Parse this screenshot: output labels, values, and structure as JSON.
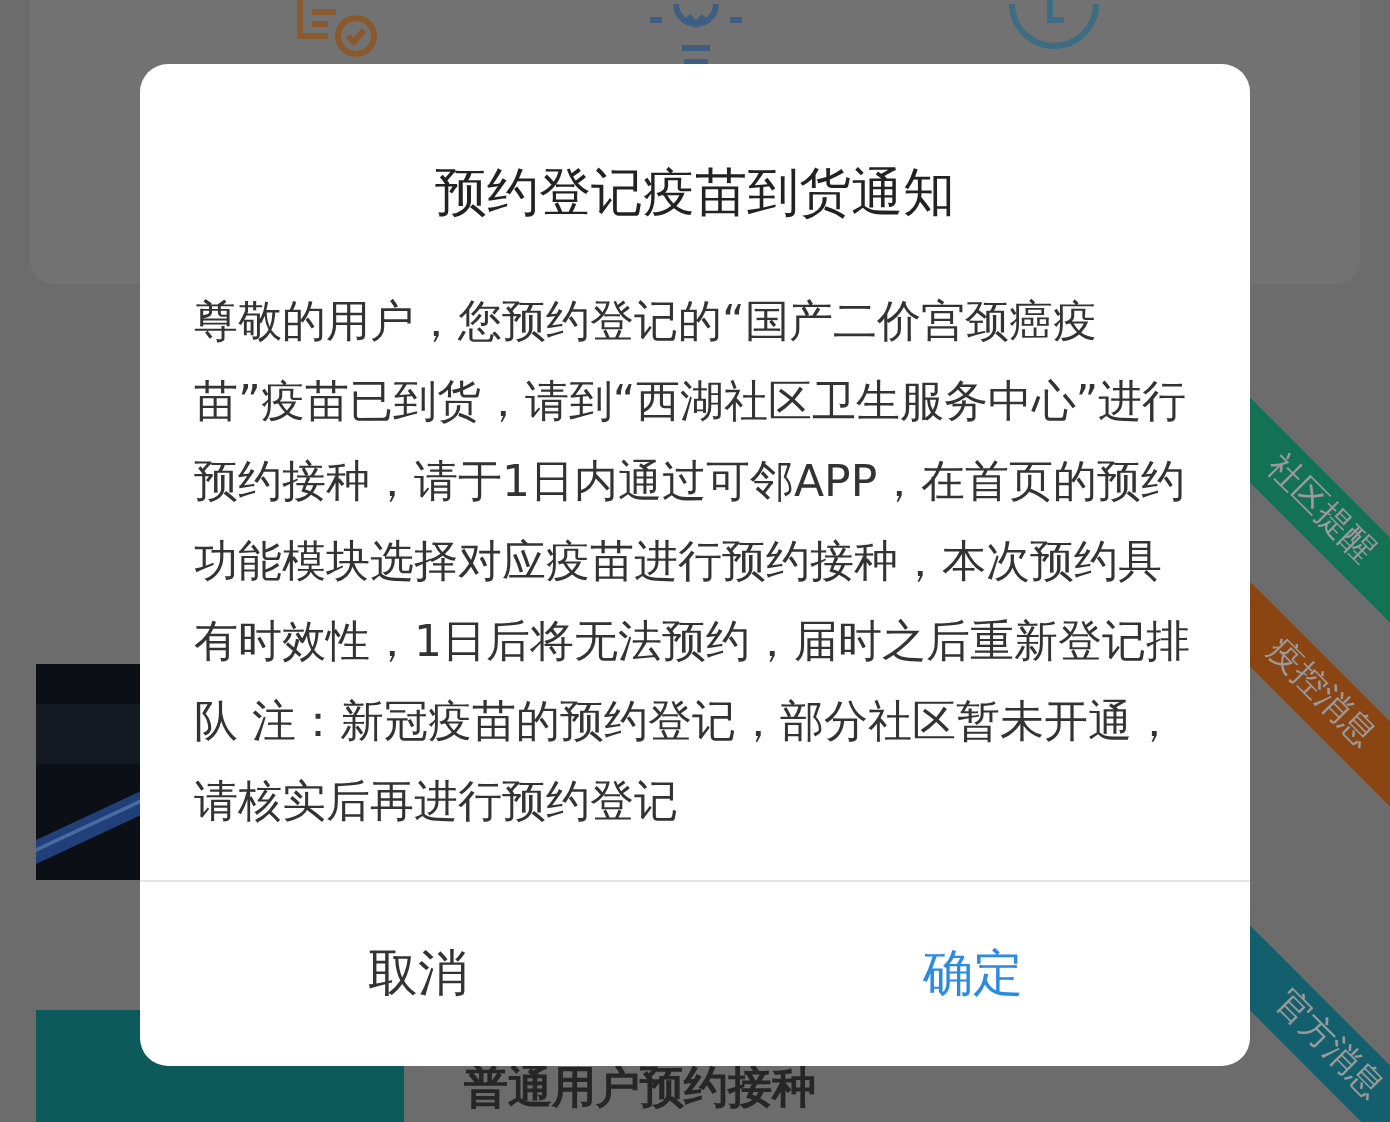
{
  "background": {
    "ribbons": [
      {
        "label": "社区提醒",
        "color": "#137254"
      },
      {
        "label": "疫控消息",
        "color": "#8a4513"
      },
      {
        "label": "官方消息",
        "color": "#135f6d"
      }
    ],
    "list_item_title": "普通用户预约接种"
  },
  "dialog": {
    "title": "预约登记疫苗到货通知",
    "message": "尊敬的用户，您预约登记的“国产二价宫颈癌疫苗”疫苗已到货，请到“西湖社区卫生服务中心”进行预约接种，请于1日内通过可邻APP，在首页的预约功能模块选择对应疫苗进行预约接种，本次预约具有时效性，1日后将无法预约，届时之后重新登记排队 注：新冠疫苗的预约登记，部分社区暂未开通，请核实后再进行预约登记",
    "buttons": [
      {
        "label": "取消",
        "kind": "cancel"
      },
      {
        "label": "确定",
        "kind": "confirm"
      }
    ]
  }
}
